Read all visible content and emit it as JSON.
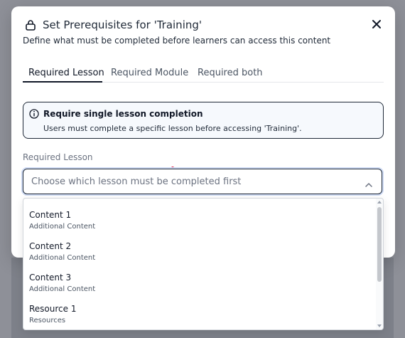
{
  "dialog": {
    "title": "Set Prerequisites for 'Training'",
    "subtitle": "Define what must be completed before learners can access this content",
    "close_icon": "close-icon",
    "title_icon": "lock-icon"
  },
  "tabs": [
    {
      "label": "Required Lesson",
      "active": true
    },
    {
      "label": "Required Module",
      "active": false
    },
    {
      "label": "Required both",
      "active": false
    }
  ],
  "info": {
    "icon": "info-icon",
    "title": "Require single lesson completion",
    "text": "Users must complete a specific lesson before accessing 'Training'."
  },
  "field": {
    "label": "Required Lesson",
    "placeholder": "Choose which lesson must be completed first",
    "expanded": true
  },
  "options": [
    {
      "label": "Content 1",
      "sub": "Additional Content"
    },
    {
      "label": "Content 2",
      "sub": "Additional Content"
    },
    {
      "label": "Content 3",
      "sub": "Additional Content"
    },
    {
      "label": "Resource 1",
      "sub": "Resources"
    }
  ],
  "colors": {
    "accent": "#111827",
    "focus_ring": "#cfdbf4",
    "info_bg": "#f6f9fd",
    "overlay": "#8e9098"
  }
}
